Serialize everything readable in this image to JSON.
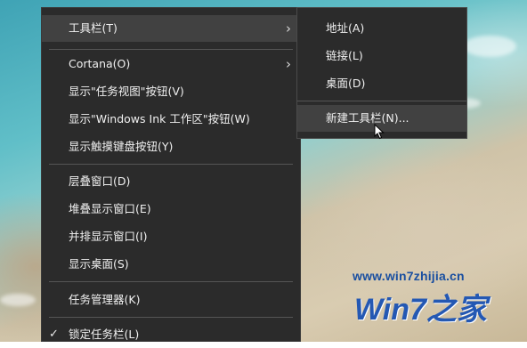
{
  "main_menu": {
    "items": [
      {
        "label": "工具栏(T)",
        "submenu": true
      },
      {
        "label": "Cortana(O)",
        "submenu": true
      },
      {
        "label": "显示\"任务视图\"按钮(V)"
      },
      {
        "label": "显示\"Windows Ink 工作区\"按钮(W)"
      },
      {
        "label": "显示触摸键盘按钮(Y)"
      },
      {
        "label": "层叠窗口(D)"
      },
      {
        "label": "堆叠显示窗口(E)"
      },
      {
        "label": "并排显示窗口(I)"
      },
      {
        "label": "显示桌面(S)"
      },
      {
        "label": "任务管理器(K)"
      },
      {
        "label": "锁定任务栏(L)",
        "checked": true
      }
    ],
    "chevron": "›",
    "check_mark": "✓"
  },
  "toolbar_submenu": {
    "items": [
      {
        "label": "地址(A)"
      },
      {
        "label": "链接(L)"
      },
      {
        "label": "桌面(D)"
      },
      {
        "label": "新建工具栏(N)..."
      }
    ]
  },
  "watermark": {
    "url": "www.win7zhijia.cn",
    "brand": "Win7之家"
  },
  "colors": {
    "menu_bg": "#2b2b2b",
    "menu_text": "#f0f0f0",
    "highlight": "#414141",
    "separator": "#555555"
  }
}
